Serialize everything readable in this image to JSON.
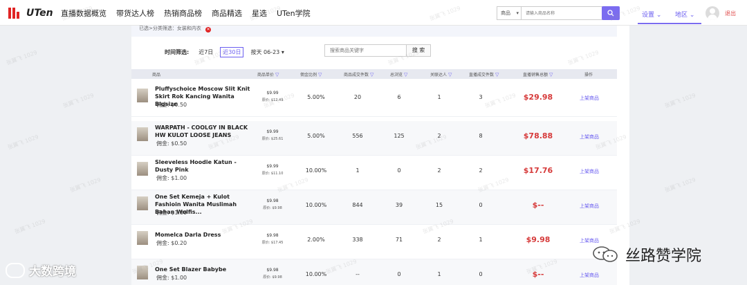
{
  "header": {
    "logo_text": "UTen",
    "nav": [
      "直播数据概览",
      "带货达人榜",
      "热销商品榜",
      "商品精选",
      "星选",
      "UTen学院"
    ],
    "search_select": "商品",
    "search_placeholder": "请输入商品名称",
    "settings": "设置",
    "region": "地区",
    "logout": "退出"
  },
  "filter": {
    "text": "已选>分类筛选：女装和内衣"
  },
  "time_filter": {
    "label": "时间筛选:",
    "options": [
      "近7日",
      "近30日",
      "按天 06-23 ▾"
    ],
    "active_index": 1
  },
  "product_search": {
    "placeholder": "搜索商品关键字",
    "button": "搜 索"
  },
  "table": {
    "headers": [
      "商品",
      "商品单价",
      "佣金比例",
      "商品成交件数",
      "总浏览",
      "关联达人",
      "直播成交件数",
      "直播销售总额",
      "操作"
    ],
    "rows": [
      {
        "name": "Pluffyschoice Moscow Slit Knit Skirt Rok Kancing Wanita Bigsize",
        "commission": "佣金: $0.50",
        "price": "$9.99",
        "original": "原价: $12.49",
        "rate": "5.00%",
        "sold": "20",
        "views": "6",
        "kol": "1",
        "live_sold": "3",
        "sales": "$29.98",
        "action": "上架商品"
      },
      {
        "name": "WARPATH - COOLGY IN BLACK HW KULOT LOOSE JEANS",
        "commission": "佣金: $0.50",
        "price": "$9.99",
        "original": "原价: $25.61",
        "rate": "5.00%",
        "sold": "556",
        "views": "125",
        "kol": "2",
        "live_sold": "8",
        "sales": "$78.88",
        "action": "上架商品"
      },
      {
        "name": "Sleeveless Hoodie Katun - Dusty Pink",
        "commission": "佣金: $1.00",
        "price": "$9.99",
        "original": "原价: $11.10",
        "rate": "10.00%",
        "sold": "1",
        "views": "0",
        "kol": "2",
        "live_sold": "2",
        "sales": "$17.76",
        "action": "上架商品"
      },
      {
        "name": "One Set Kemeja + Kulot Fashioin Wanita Muslimah Bahan Wolfis...",
        "commission": "佣金: $1.00",
        "price": "$9.98",
        "original": "原价: $9.98",
        "rate": "10.00%",
        "sold": "844",
        "views": "39",
        "kol": "15",
        "live_sold": "0",
        "sales": "$--",
        "action": "上架商品"
      },
      {
        "name": "Momelca Darla Dress",
        "commission": "佣金: $0.20",
        "price": "$9.98",
        "original": "原价: $17.45",
        "rate": "2.00%",
        "sold": "338",
        "views": "71",
        "kol": "2",
        "live_sold": "1",
        "sales": "$9.98",
        "action": "上架商品"
      },
      {
        "name": "One Set Blazer Babybe",
        "commission": "佣金: $1.00",
        "price": "$9.98",
        "original": "原价: $9.98",
        "rate": "10.00%",
        "sold": "--",
        "views": "0",
        "kol": "1",
        "live_sold": "0",
        "sales": "$--",
        "action": "上架商品"
      }
    ]
  },
  "watermark": "张翼飞 1029",
  "overlay": {
    "left": "大数跨境",
    "right": "丝路赞学院"
  },
  "colors": {
    "accent": "#6a5df0",
    "sales_red": "#d63a3a",
    "logo_red": "#e02424"
  }
}
